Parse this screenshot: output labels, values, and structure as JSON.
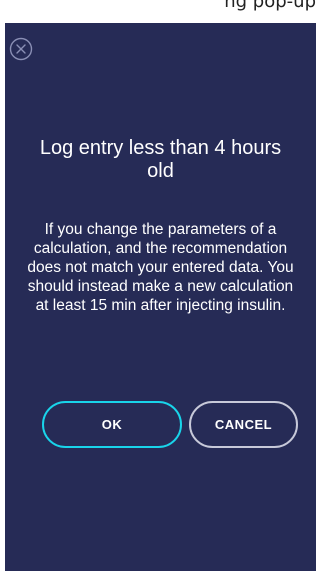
{
  "top_strip": {
    "partial_text": "ng pop-up"
  },
  "dialog": {
    "title": "Log entry less than 4 hours old",
    "message": "If you change the parameters of a calculation, and the recommendation does not match your entered data. You should instead make a new calculation at least 15 min after injecting insulin.",
    "ok_label": "OK",
    "cancel_label": "CANCEL",
    "close_icon": "close-circle-icon"
  },
  "colors": {
    "dialog_background": "#262b56",
    "ok_border": "#19d4ea",
    "cancel_border": "#c7c9d9",
    "text": "#ffffff"
  }
}
